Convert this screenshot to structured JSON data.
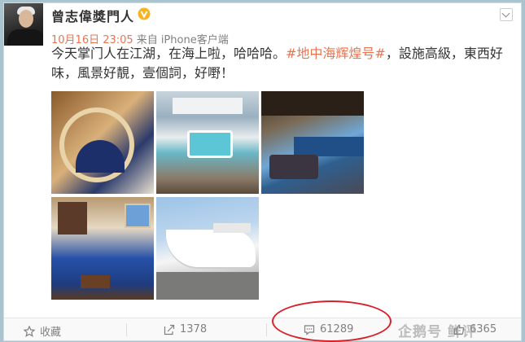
{
  "post": {
    "author": "曾志偉獎門人",
    "time": "10月16日 23:05",
    "source": "来自 iPhone客户端",
    "text_before": "今天掌门人在江湖，在海上啦，哈哈哈。",
    "topic": "#地中海辉煌号#",
    "text_after": "，設施高級，東西好味，風景好靚，壹個詞，好嘢！"
  },
  "actions": {
    "favorite_label": "收藏",
    "forward_count": "1378",
    "comment_count": "61289",
    "like_count": "6365"
  },
  "watermark": "企鹅号 鲜评",
  "colors": {
    "accent": "#eb7350",
    "annotation": "#d8202a",
    "verified": "#f6b420"
  }
}
